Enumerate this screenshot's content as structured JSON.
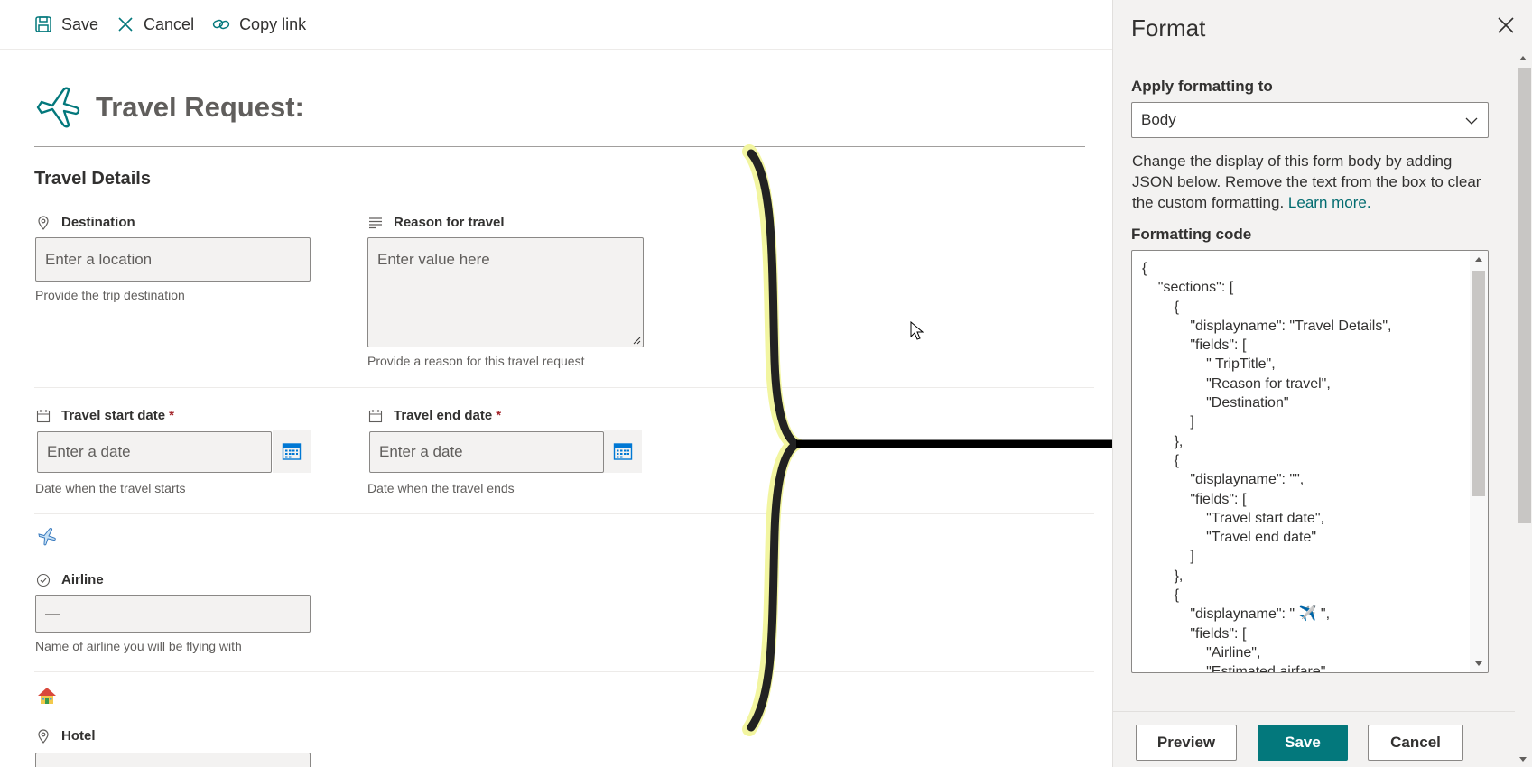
{
  "toolbar": {
    "save_label": "Save",
    "cancel_label": "Cancel",
    "copy_link_label": "Copy link"
  },
  "form": {
    "title": "Travel Request:",
    "section_title": "Travel Details",
    "destination": {
      "label": "Destination",
      "placeholder": "Enter a location",
      "help": "Provide the trip destination"
    },
    "reason": {
      "label": "Reason for travel",
      "placeholder": "Enter value here",
      "help": "Provide a reason for this travel request"
    },
    "start_date": {
      "label": "Travel start date",
      "required_mark": "*",
      "placeholder": "Enter a date",
      "help": "Date when the travel starts"
    },
    "end_date": {
      "label": "Travel end date",
      "required_mark": "*",
      "placeholder": "Enter a date",
      "help": "Date when the travel ends"
    },
    "airline": {
      "label": "Airline",
      "value": "—",
      "help": "Name of airline you will be flying with"
    },
    "hotel": {
      "label": "Hotel"
    }
  },
  "panel": {
    "title": "Format",
    "apply_label": "Apply formatting to",
    "apply_value": "Body",
    "description": "Change the display of this form body by adding JSON below. Remove the text from the box to clear the custom formatting.",
    "learn_more": "Learn more.",
    "code_label": "Formatting code",
    "code_lines": [
      "{",
      "    \"sections\": [",
      "        {",
      "            \"displayname\": \"Travel Details\",",
      "            \"fields\": [",
      "                \" TripTitle\",",
      "                \"Reason for travel\",",
      "                \"Destination\"",
      "            ]",
      "        },",
      "        {",
      "            \"displayname\": \"\",",
      "            \"fields\": [",
      "                \"Travel start date\",",
      "                \"Travel end date\"",
      "            ]",
      "        },",
      "        {",
      "            \"displayname\": \" ✈️ \",",
      "            \"fields\": [",
      "                \"Airline\",",
      "                \"Estimated airfare\""
    ],
    "preview_label": "Preview",
    "save_label": "Save",
    "cancel_label": "Cancel"
  },
  "icons": {
    "accent": "#03787c",
    "calendar": "#0078d4"
  }
}
